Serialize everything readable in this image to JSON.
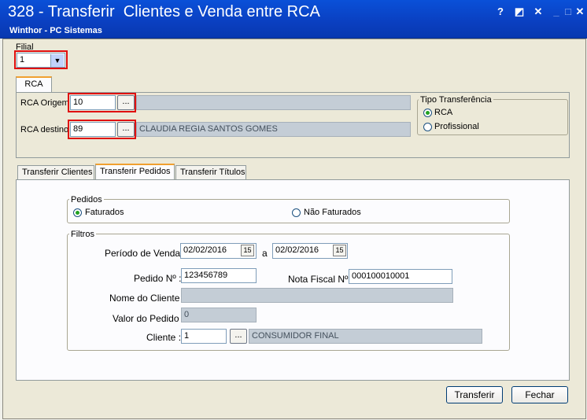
{
  "window": {
    "title": "328 - Transferir  Clientes e Venda entre RCA",
    "subtitle": "Winthor - PC Sistemas",
    "buttons": [
      "?",
      "◩",
      "✕",
      "_",
      "□",
      "✕"
    ]
  },
  "filial": {
    "label": "Filial",
    "value": "1"
  },
  "top_tabs": {
    "rca": "RCA"
  },
  "rca": {
    "origem_label": "RCA Origem",
    "origem_value": "10",
    "origem_name": "",
    "destino_label": "RCA destino",
    "destino_value": "89",
    "destino_name": "CLAUDIA REGIA SANTOS GOMES",
    "browse": "..."
  },
  "tipo_transferencia": {
    "label": "Tipo Transferência",
    "options": [
      "RCA",
      "Profissional"
    ],
    "selected": "RCA"
  },
  "tabs": [
    "Transferir Clientes",
    "Transferir Pedidos",
    "Transferir Títulos"
  ],
  "active_tab": "Transferir Pedidos",
  "pedidos": {
    "label": "Pedidos",
    "options": [
      "Faturados",
      "Não Faturados"
    ],
    "selected": "Faturados"
  },
  "filtros": {
    "label": "Filtros",
    "periodo_label": "Período de Venda :",
    "periodo_de": "02/02/2016",
    "periodo_a_label": "a",
    "periodo_ate": "02/02/2016",
    "calendar_icon": "15",
    "pedido_label": "Pedido Nº :",
    "pedido_value": "123456789",
    "nota_label": "Nota Fiscal Nº:",
    "nota_value": "000100010001",
    "nome_cliente_label": "Nome do Cliente :",
    "nome_cliente_value": "",
    "valor_label": "Valor do Pedido :",
    "valor_value": "0",
    "cliente_label": "Cliente :",
    "cliente_code": "1",
    "cliente_name": "CONSUMIDOR FINAL"
  },
  "actions": {
    "transferir": "Transferir",
    "fechar": "Fechar"
  },
  "colors": {
    "title_bar": "#0a50d8",
    "highlight": "#e01010",
    "active_tab_border": "#f0a030"
  }
}
